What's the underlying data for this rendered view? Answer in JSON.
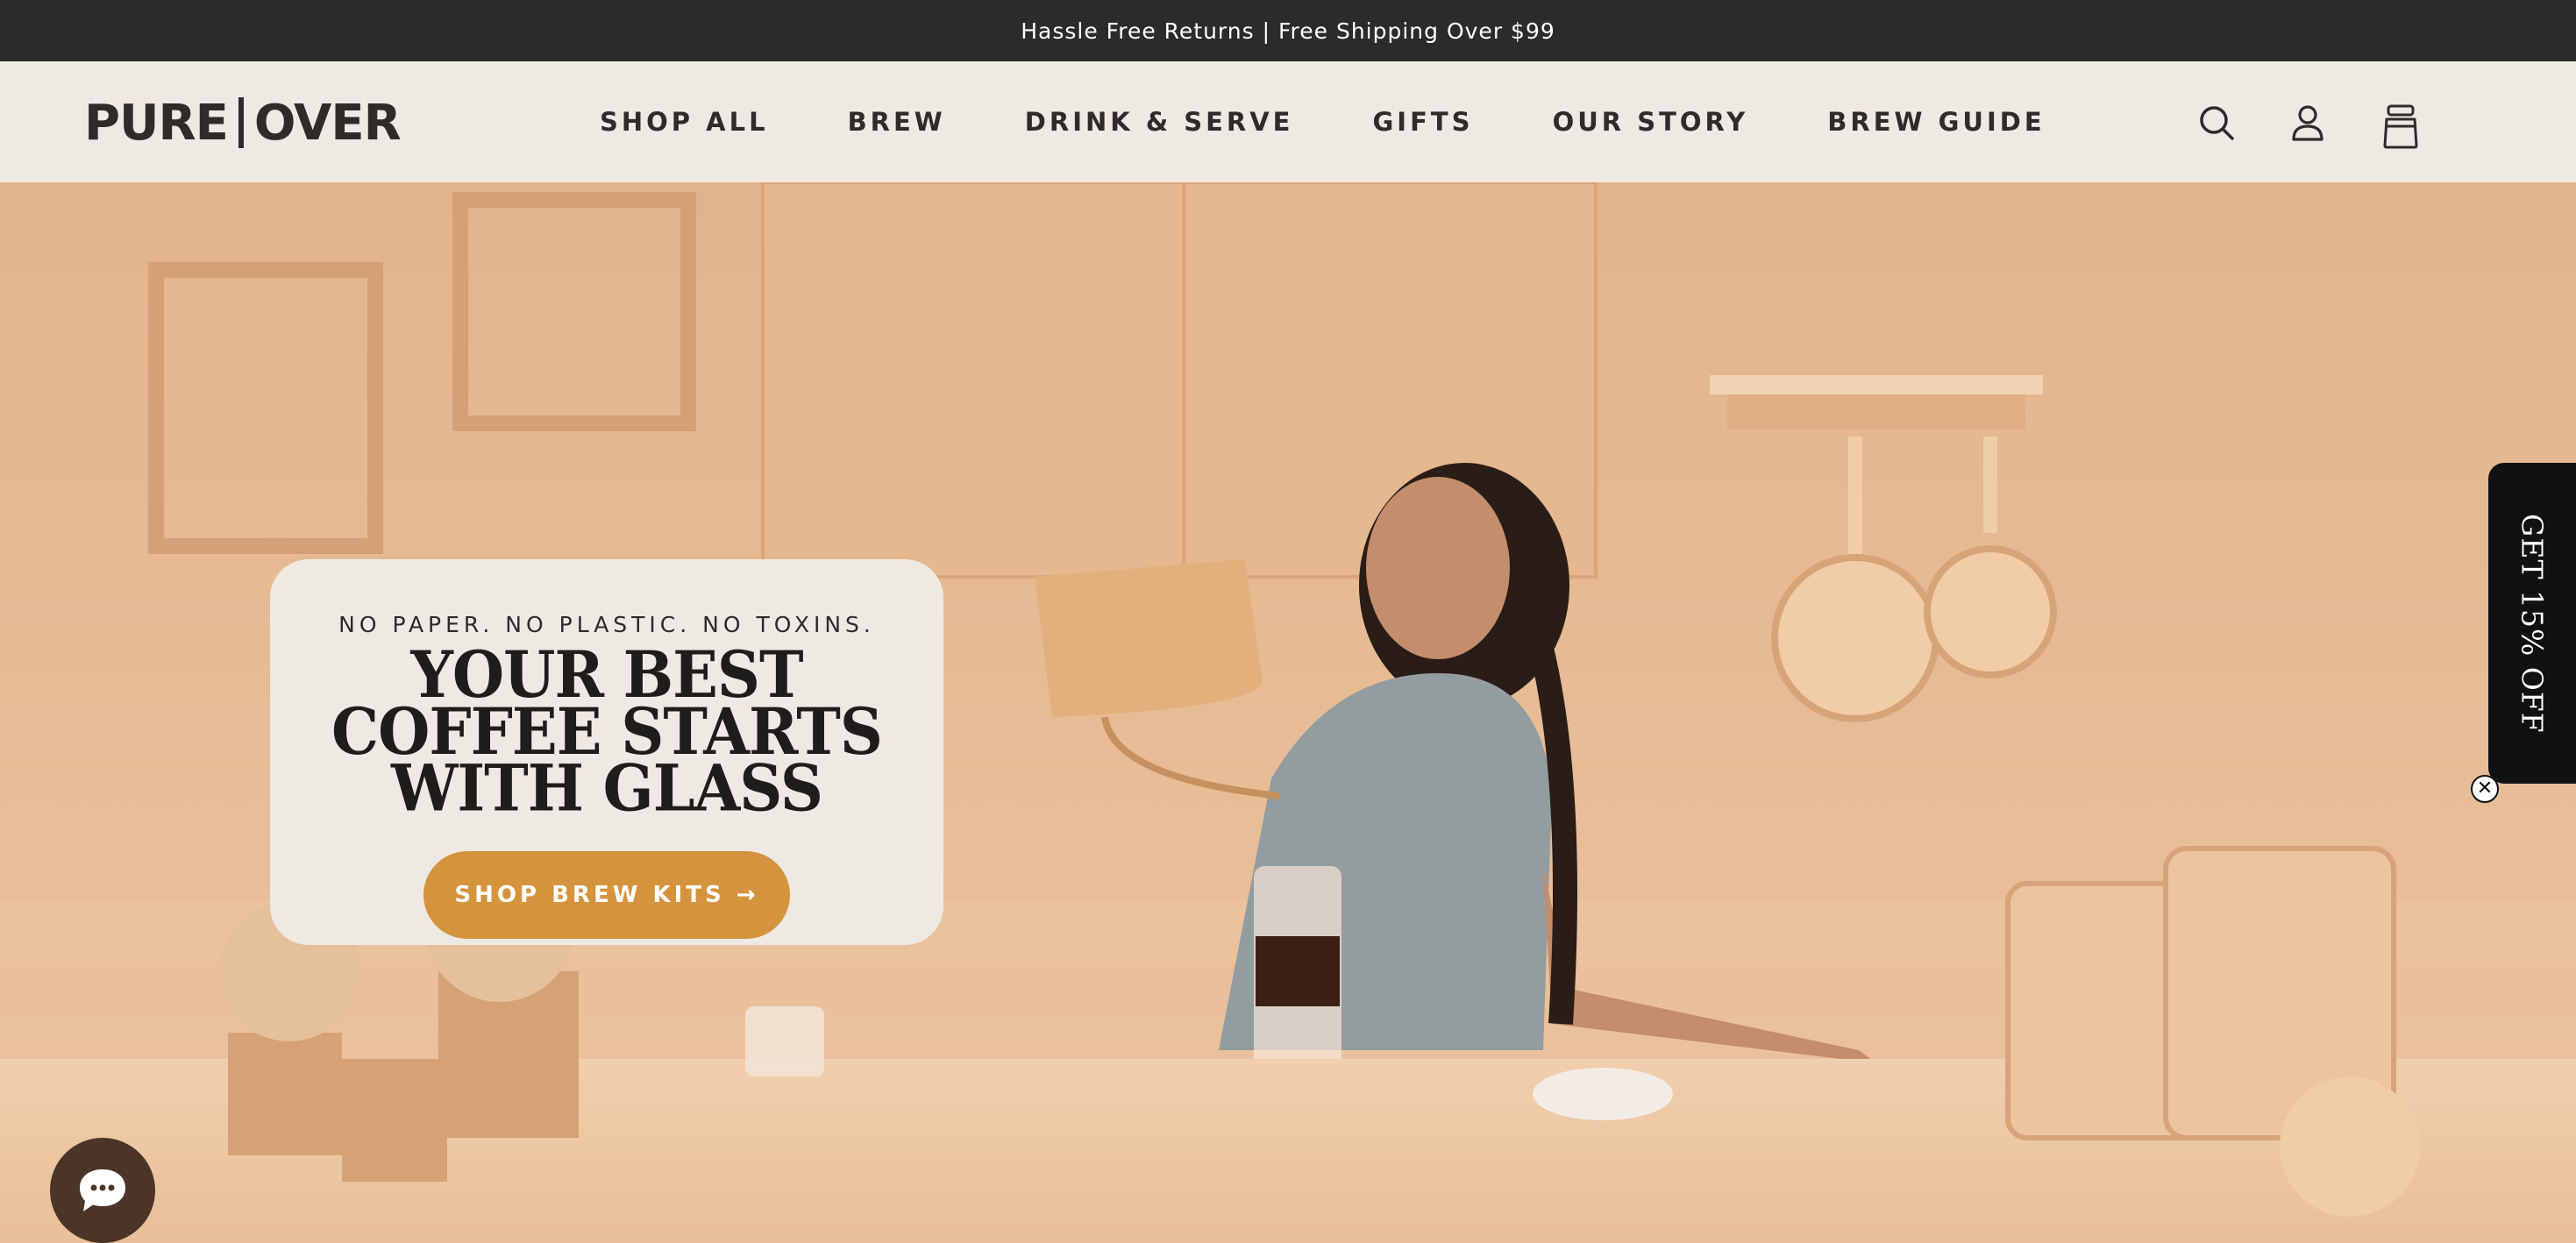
{
  "announcement": {
    "text": "Hassle Free Returns | Free Shipping Over $99"
  },
  "header": {
    "logo": {
      "left": "PURE",
      "right": "OVER"
    },
    "nav": [
      {
        "label": "SHOP ALL"
      },
      {
        "label": "BREW"
      },
      {
        "label": "DRINK & SERVE"
      },
      {
        "label": "GIFTS"
      },
      {
        "label": "OUR STORY"
      },
      {
        "label": "BREW GUIDE"
      }
    ],
    "icons": [
      "search-icon",
      "account-icon",
      "cart-icon"
    ]
  },
  "hero": {
    "eyebrow": "NO PAPER. NO PLASTIC. NO TOXINS.",
    "headline": "YOUR BEST COFFEE STARTS WITH GLASS",
    "cta_label": "SHOP BREW KITS →"
  },
  "promo": {
    "label": "GET 15% OFF",
    "close_glyph": "✕"
  },
  "chat": {
    "icon": "chat-bubble-icon"
  },
  "colors": {
    "announce_bg": "#2b2b2b",
    "header_bg": "#efe9e3",
    "hero_bg": "#e6b992",
    "cta": "#d4933d",
    "chat": "#4a3527",
    "promo_bg": "#111111",
    "text_dark": "#2e2b28"
  }
}
